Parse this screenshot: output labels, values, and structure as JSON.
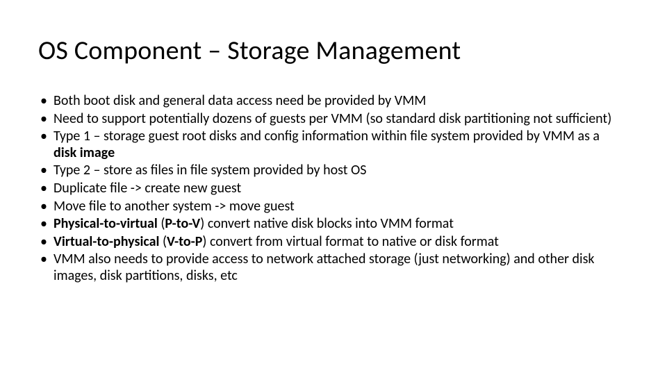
{
  "title": "OS Component – Storage Management",
  "bullets": [
    {
      "segments": [
        {
          "t": "Both boot disk and general data access need  be provided by VMM"
        }
      ]
    },
    {
      "segments": [
        {
          "t": "Need to support potentially dozens of guests per VMM (so standard disk partitioning not sufficient)"
        }
      ]
    },
    {
      "segments": [
        {
          "t": "Type 1 – storage guest root disks and config information within file system provided by VMM as a "
        },
        {
          "t": "disk image",
          "b": true
        }
      ]
    },
    {
      "segments": [
        {
          "t": "Type 2 – store as files in file system provided by host OS"
        }
      ]
    },
    {
      "segments": [
        {
          "t": "Duplicate file -> create new guest"
        }
      ]
    },
    {
      "segments": [
        {
          "t": "Move file to another system -> move guest"
        }
      ]
    },
    {
      "segments": [
        {
          "t": "Physical-to-virtual",
          "b": true
        },
        {
          "t": " ("
        },
        {
          "t": "P-to-V",
          "b": true
        },
        {
          "t": ") convert native disk blocks into VMM format"
        }
      ]
    },
    {
      "segments": [
        {
          "t": "Virtual-to-physical",
          "b": true
        },
        {
          "t": " ("
        },
        {
          "t": "V-to-P",
          "b": true
        },
        {
          "t": ") convert from virtual format to native or disk format"
        }
      ]
    },
    {
      "segments": [
        {
          "t": "VMM also needs to provide access to network attached storage (just networking) and other disk images, disk partitions, disks, etc"
        }
      ]
    }
  ]
}
